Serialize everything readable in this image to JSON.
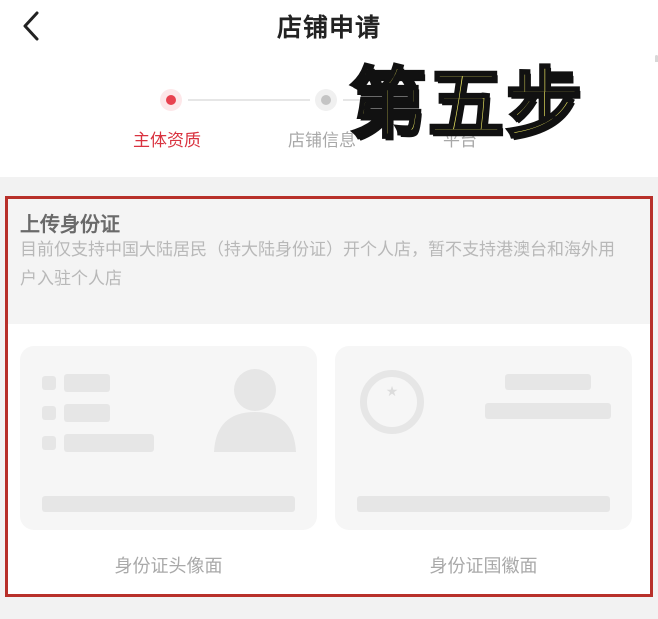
{
  "header": {
    "title": "店铺申请",
    "back_icon": "chevron-left-icon"
  },
  "steps": [
    {
      "label": "主体资质",
      "active": true
    },
    {
      "label": "店铺信息",
      "active": false
    },
    {
      "label": "平台",
      "active": false
    }
  ],
  "overlay": {
    "text": "第五步"
  },
  "upload": {
    "title": "上传身份证",
    "description": "目前仅支持中国大陆居民（持大陆身份证）开个人店，暂不支持港澳台和海外用户入驻个人店",
    "front_label": "身份证头像面",
    "back_label": "身份证国徽面"
  },
  "colors": {
    "accent": "#e8424f",
    "overlay_text": "#f3ee63",
    "highlight_border": "#b8302a"
  }
}
